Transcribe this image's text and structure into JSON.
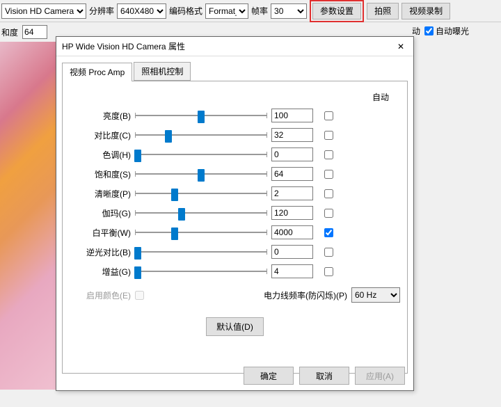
{
  "topbar": {
    "camera_select": "Vision HD Camera",
    "resolution_label": "分辨率",
    "resolution_select": "640X480",
    "encode_label": "编码格式",
    "encode_select": "Format_",
    "fps_label": "帧率",
    "fps_select": "30",
    "settings_btn": "参数设置",
    "shoot_btn": "拍照",
    "record_btn": "视频录制"
  },
  "secondbar": {
    "sat_label": "和度",
    "sat_value": "64",
    "auto_label": "动",
    "auto_exposure": "自动曝光"
  },
  "dialog": {
    "title": "HP Wide Vision HD Camera 属性",
    "tabs": {
      "video": "视频 Proc Amp",
      "camera": "照相机控制"
    },
    "auto_header": "自动",
    "props": [
      {
        "label": "亮度(B)",
        "value": "100",
        "pos": 50
      },
      {
        "label": "对比度(C)",
        "value": "32",
        "pos": 25
      },
      {
        "label": "色调(H)",
        "value": "0",
        "pos": 2
      },
      {
        "label": "饱和度(S)",
        "value": "64",
        "pos": 50
      },
      {
        "label": "清晰度(P)",
        "value": "2",
        "pos": 30
      },
      {
        "label": "伽玛(G)",
        "value": "120",
        "pos": 35
      },
      {
        "label": "白平衡(W)",
        "value": "4000",
        "pos": 30
      },
      {
        "label": "逆光对比(B)",
        "value": "0",
        "pos": 2
      },
      {
        "label": "增益(G)",
        "value": "4",
        "pos": 2
      }
    ],
    "enable_color": "启用颜色(E)",
    "freq_label": "电力线频率(防闪烁)(P)",
    "freq_value": "60 Hz",
    "defaults_btn": "默认值(D)",
    "ok": "确定",
    "cancel": "取消",
    "apply": "应用(A)"
  }
}
